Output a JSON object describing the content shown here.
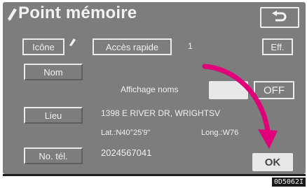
{
  "header": {
    "title": "Point mémoire",
    "back_icon": "return-arrow-icon",
    "title_icon": "pencil-icon"
  },
  "buttons": {
    "icon": "Icône",
    "quick_access": "Accès rapide",
    "delete": "Eff.",
    "name": "Nom",
    "location": "Lieu",
    "phone": "No. tél.",
    "ok": "OK"
  },
  "display_names": {
    "label": "Affichage noms",
    "on_label": "",
    "off_label": "OFF"
  },
  "location": {
    "address": "1398 E RIVER DR, WRIGHTSV",
    "latitude": "Lat.:N40°25'9\"",
    "longitude": "Long.:W76"
  },
  "phone": {
    "number": "2024567041"
  },
  "image_code": "0D5062I",
  "colors": {
    "screen_bg": "#7d7d7d",
    "text": "#f1f1f1",
    "arrow": "#e0007a"
  }
}
